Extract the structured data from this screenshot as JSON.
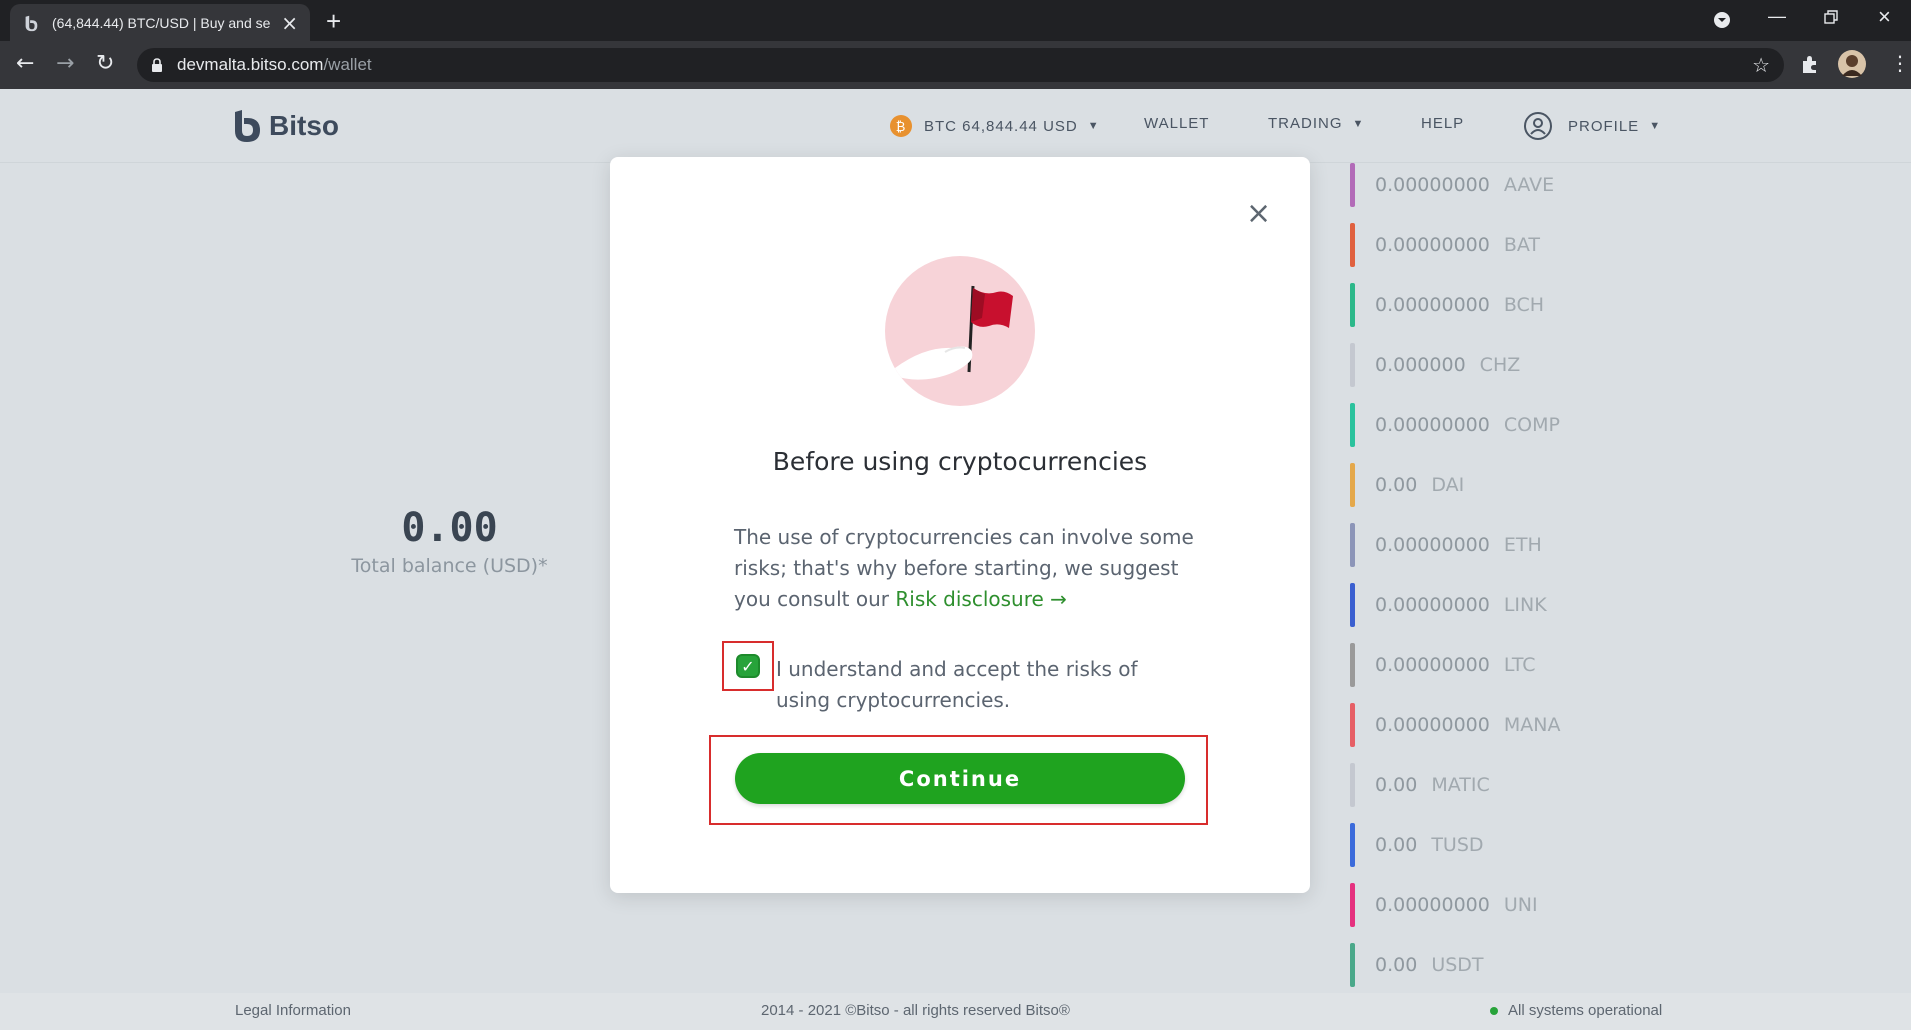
{
  "browser": {
    "tab_title": "(64,844.44) BTC/USD | Buy and se",
    "url_host": "devmalta.bitso.com",
    "url_path": "/wallet"
  },
  "header": {
    "logo_text": "Bitso",
    "ticker": "BTC 64,844.44 USD",
    "nav": [
      "WALLET",
      "TRADING",
      "HELP",
      "PROFILE"
    ]
  },
  "balance": {
    "value": "0.00",
    "label": "Total balance (USD)*"
  },
  "coins": [
    {
      "amount": "0.00000000",
      "symbol": "AAVE",
      "color": "#b26bb8"
    },
    {
      "amount": "0.00000000",
      "symbol": "BAT",
      "color": "#e0613f"
    },
    {
      "amount": "0.00000000",
      "symbol": "BCH",
      "color": "#2cb88a"
    },
    {
      "amount": "0.000000",
      "symbol": "CHZ",
      "color": "#c4c8d0"
    },
    {
      "amount": "0.00000000",
      "symbol": "COMP",
      "color": "#2ac29d"
    },
    {
      "amount": "0.00",
      "symbol": "DAI",
      "color": "#e4a84b"
    },
    {
      "amount": "0.00000000",
      "symbol": "ETH",
      "color": "#8c95b8"
    },
    {
      "amount": "0.00000000",
      "symbol": "LINK",
      "color": "#3a5fd0"
    },
    {
      "amount": "0.00000000",
      "symbol": "LTC",
      "color": "#9a9a9a"
    },
    {
      "amount": "0.00000000",
      "symbol": "MANA",
      "color": "#e65f66"
    },
    {
      "amount": "0.00",
      "symbol": "MATIC",
      "color": "#c4c8d0"
    },
    {
      "amount": "0.00",
      "symbol": "TUSD",
      "color": "#3b6bdb"
    },
    {
      "amount": "0.00000000",
      "symbol": "UNI",
      "color": "#e5317f"
    },
    {
      "amount": "0.00",
      "symbol": "USDT",
      "color": "#4aa88a"
    }
  ],
  "modal": {
    "title": "Before using cryptocurrencies",
    "body_text": "The use of cryptocurrencies can involve some risks; that's why before starting, we suggest you consult our ",
    "link_text": "Risk disclosure →",
    "checkbox_label": "I understand and accept the risks of using cryptocurrencies.",
    "button_label": "Continue"
  },
  "footer": {
    "legal": "Legal Information",
    "copyright": "2014 - 2021 ©Bitso - all rights reserved Bitso®",
    "status": "All systems operational"
  }
}
